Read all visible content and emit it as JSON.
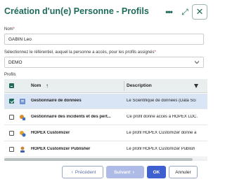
{
  "dialog": {
    "title": "Création d'un(e) Personne - Profils",
    "more_glyph": "•••",
    "expand_glyph": "⤢",
    "close_glyph": "✕"
  },
  "form": {
    "nom_label": "Nom",
    "required_mark": "*",
    "nom_value": "GABIN Leo",
    "ref_label": "Sélectionnez le référentiel, auquel la personne a accès, pour les profils assignés",
    "ref_value": "DEMO",
    "profils_label": "Profils"
  },
  "table": {
    "col_name": "Nom",
    "sort_glyph": "↑",
    "col_desc": "Description",
    "header_checkbox": "partial",
    "rows": [
      {
        "name": "Gestionnaire de données",
        "description": "Le Scientifique de données (Data Sci",
        "checked": true,
        "selected": true,
        "icon": "data-manager-icon"
      },
      {
        "name": "Gestionnaire des incidents et des pert...",
        "description": "Ce profil donne accès à HOPEX LDC.",
        "checked": false,
        "selected": false,
        "icon": "incident-manager-icon"
      },
      {
        "name": "HOPEX Customizer",
        "description": "Le profil HOPEX Customizer donne a",
        "checked": false,
        "selected": false,
        "icon": "customizer-icon"
      },
      {
        "name": "HOPEX Customizer Publisher",
        "description": "Le profil HOPEX Customizer Publish",
        "checked": false,
        "selected": false,
        "icon": "customizer-publisher-icon"
      }
    ]
  },
  "footer": {
    "prev_label": "Précédent",
    "prev_glyph": "‹",
    "next_label": "Suivant",
    "next_glyph": "›",
    "ok_label": "OK",
    "cancel_label": "Annuler"
  },
  "colors": {
    "accent": "#1e6b5b",
    "primary_button": "#3d5fd0",
    "disabled_button": "#aebbe6",
    "selected_row": "#d9e4f5"
  }
}
